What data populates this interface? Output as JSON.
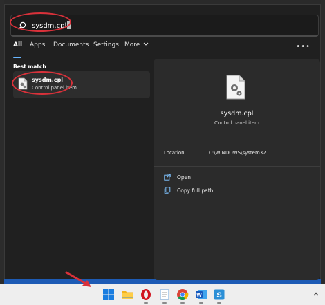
{
  "search": {
    "query": "sysdm.cpl"
  },
  "tabs": [
    {
      "label": "All",
      "active": true
    },
    {
      "label": "Apps"
    },
    {
      "label": "Documents"
    },
    {
      "label": "Settings"
    },
    {
      "label": "More"
    }
  ],
  "best_match": {
    "section_title": "Best match",
    "title": "sysdm.cpl",
    "subtitle": "Control panel item"
  },
  "detail": {
    "title": "sysdm.cpl",
    "subtitle": "Control panel item",
    "location_label": "Location",
    "location_value": "C:\\WINDOWS\\system32",
    "actions": [
      {
        "label": "Open",
        "icon": "open-external-icon"
      },
      {
        "label": "Copy full path",
        "icon": "copy-icon"
      }
    ]
  },
  "taskbar": {
    "icons": [
      "windows-start-icon",
      "file-explorer-icon",
      "opera-icon",
      "notepad-icon",
      "chrome-icon",
      "word-icon",
      "sysdm-app-icon"
    ]
  },
  "colors": {
    "accent": "#68b6ff",
    "annotation": "#d9313a",
    "panel": "#202020",
    "taskbar": "#eeeeee"
  }
}
